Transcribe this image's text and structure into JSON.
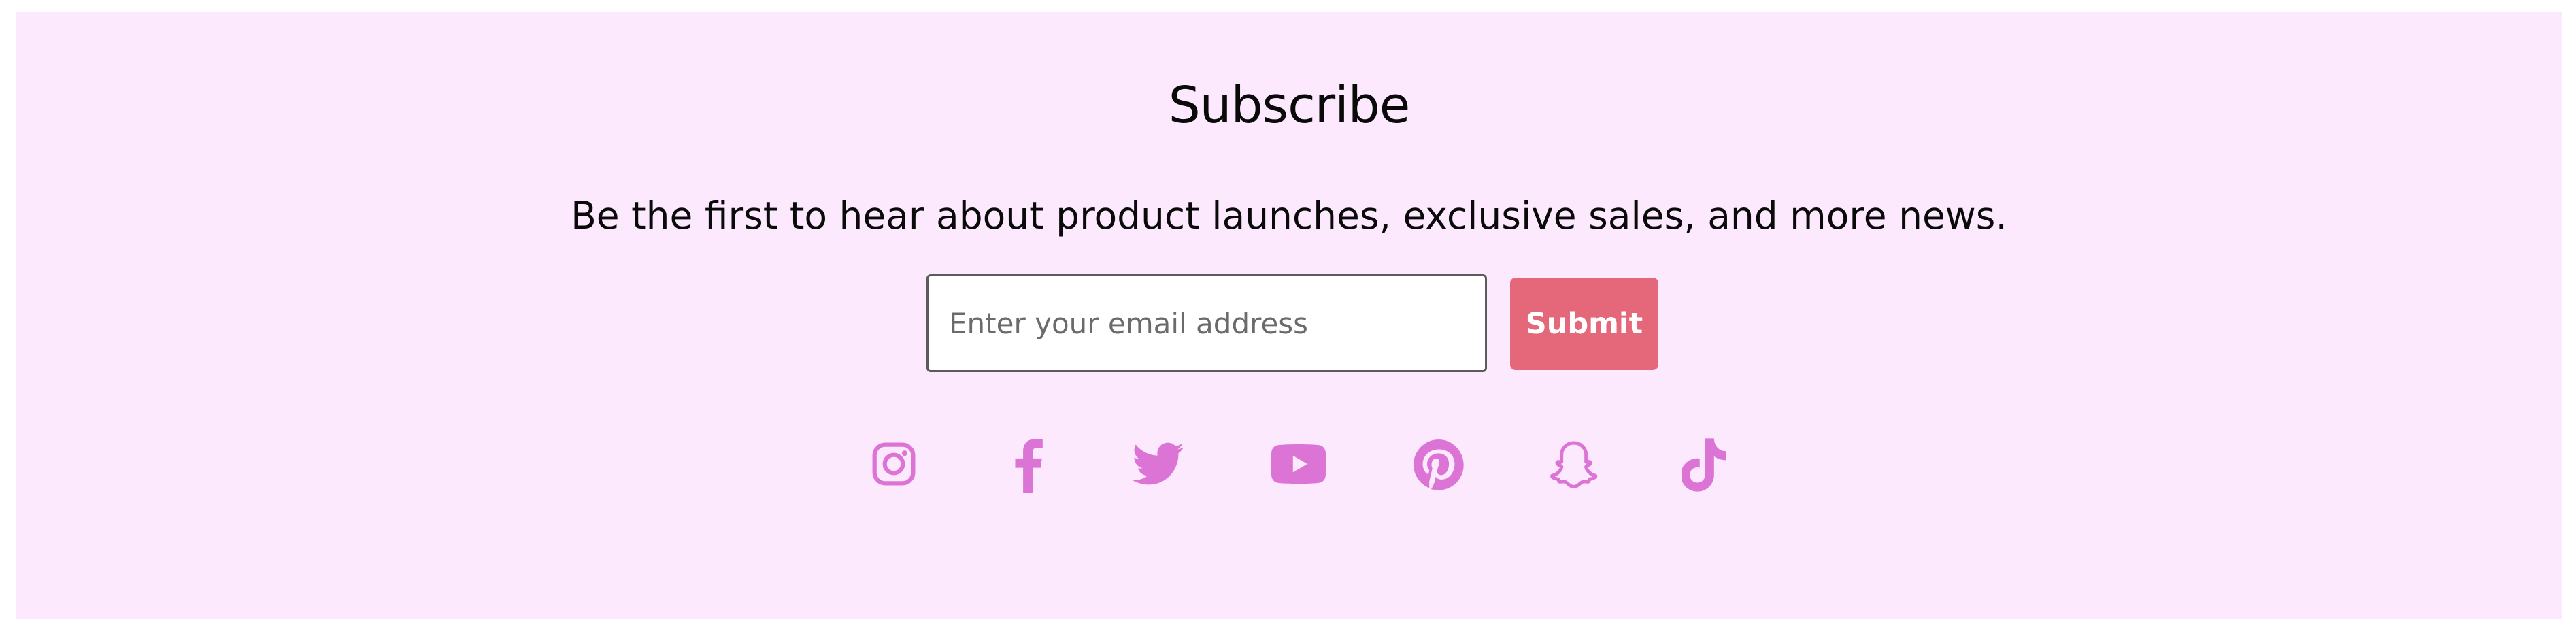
{
  "subscribe": {
    "title": "Subscribe",
    "description": "Be the first to hear about product launches, exclusive sales, and more news.",
    "email_placeholder": "Enter your email address",
    "submit_label": "Submit"
  },
  "colors": {
    "panel_background": "#fde9fe",
    "submit_background": "#e4687a",
    "social_icon": "#db74d5"
  },
  "social_links": [
    {
      "icon": "instagram-icon"
    },
    {
      "icon": "facebook-icon"
    },
    {
      "icon": "twitter-icon"
    },
    {
      "icon": "youtube-icon"
    },
    {
      "icon": "pinterest-icon"
    },
    {
      "icon": "snapchat-icon"
    },
    {
      "icon": "tiktok-icon"
    }
  ]
}
